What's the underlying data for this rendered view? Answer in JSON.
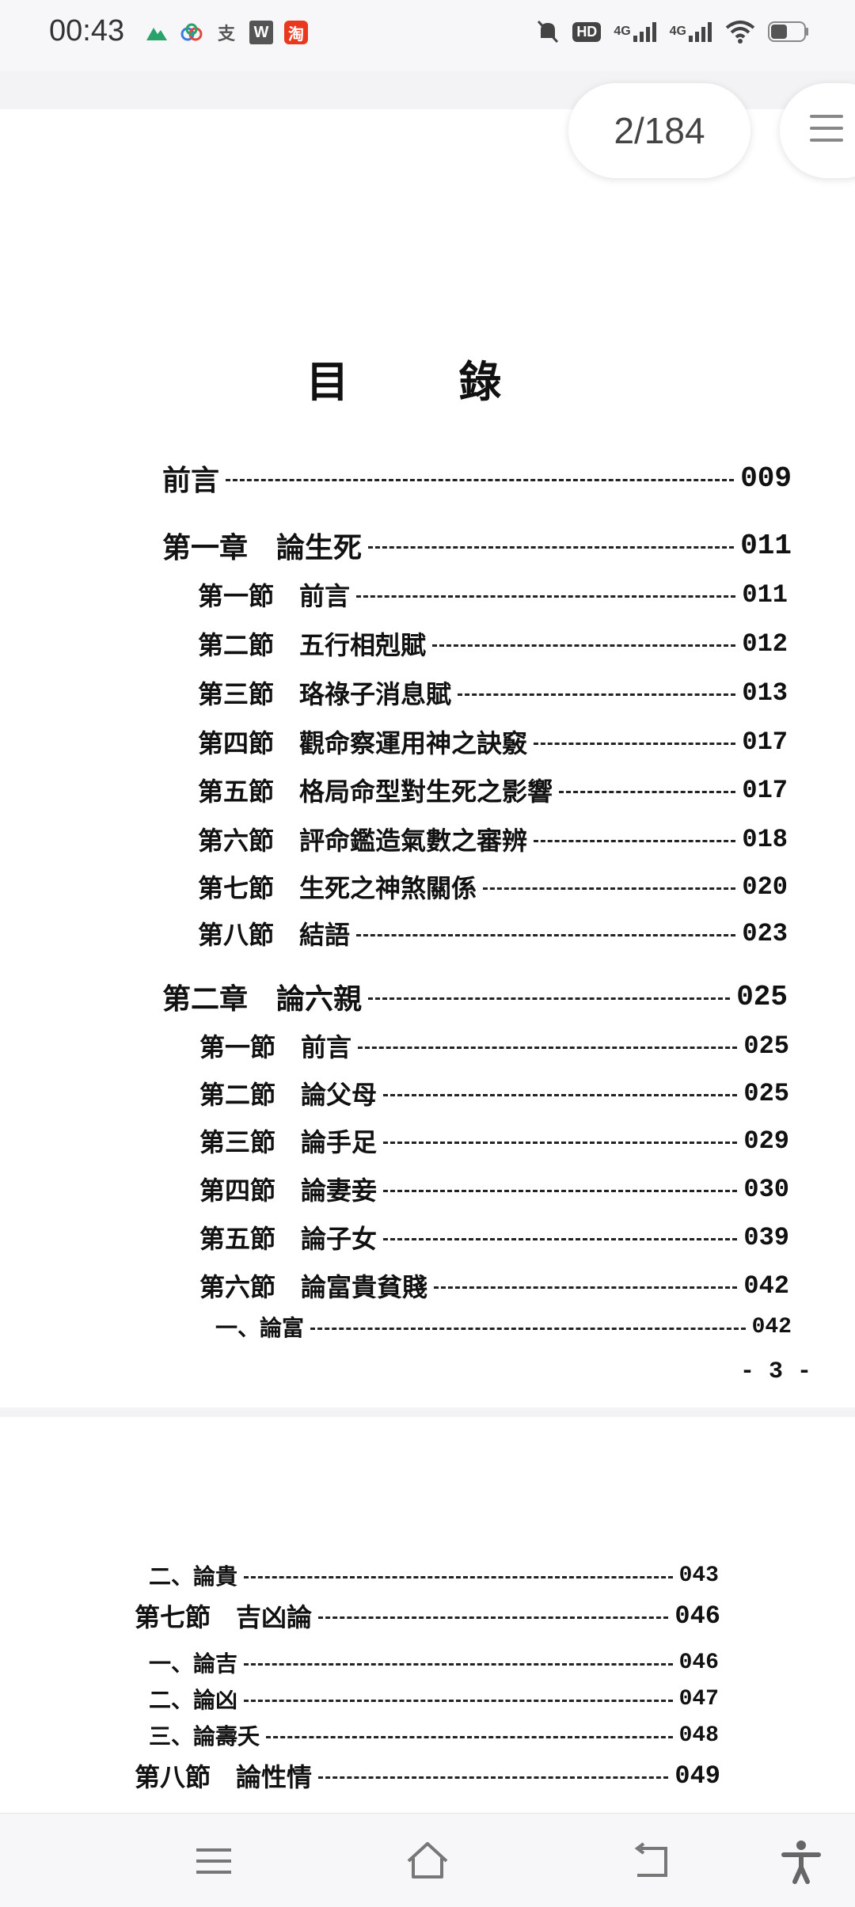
{
  "status_bar": {
    "time": "00:43",
    "app_icons": [
      "mountain-icon",
      "cloud-icon",
      "alipay-icon",
      "wps-icon",
      "taobao-icon"
    ],
    "app_glyphs": {
      "alipay": "支",
      "wps": "W",
      "taobao": "淘"
    },
    "network": [
      "HD",
      "4G",
      "4G"
    ],
    "system_icons": [
      "mute-icon",
      "hd-icon",
      "signal-icon",
      "signal-icon",
      "wifi-icon",
      "battery-icon"
    ]
  },
  "reader": {
    "page_indicator": "2/184"
  },
  "page_top": {
    "title": "目 錄",
    "page_footer": "- 3 -",
    "entries": [
      {
        "label": "前言",
        "page": "009"
      },
      {
        "label": "第一章　論生死",
        "page": "011"
      },
      {
        "label": "第一節　前言",
        "page": "011"
      },
      {
        "label": "第二節　五行相剋賦",
        "page": "012"
      },
      {
        "label": "第三節　珞祿子消息賦",
        "page": "013"
      },
      {
        "label": "第四節　觀命察運用神之訣竅",
        "page": "017"
      },
      {
        "label": "第五節　格局命型對生死之影響",
        "page": "017"
      },
      {
        "label": "第六節　評命鑑造氣數之審辨",
        "page": "018"
      },
      {
        "label": "第七節　生死之神煞關係",
        "page": "020"
      },
      {
        "label": "第八節　結語",
        "page": "023"
      },
      {
        "label": "第二章　論六親",
        "page": "025"
      },
      {
        "label": "第一節　前言",
        "page": "025"
      },
      {
        "label": "第二節　論父母",
        "page": "025"
      },
      {
        "label": "第三節　論手足",
        "page": "029"
      },
      {
        "label": "第四節　論妻妾",
        "page": "030"
      },
      {
        "label": "第五節　論子女",
        "page": "039"
      },
      {
        "label": "第六節　論富貴貧賤",
        "page": "042"
      },
      {
        "label": "一、論富",
        "page": "042"
      }
    ]
  },
  "page_bottom": {
    "entries": [
      {
        "label": "二、論貴",
        "page": "043"
      },
      {
        "label": "第七節　吉凶論",
        "page": "046"
      },
      {
        "label": "一、論吉",
        "page": "046"
      },
      {
        "label": "二、論凶",
        "page": "047"
      },
      {
        "label": "三、論壽夭",
        "page": "048"
      },
      {
        "label": "第八節　論性情",
        "page": "049"
      }
    ]
  },
  "nav": {
    "buttons": [
      "menu-icon",
      "home-icon",
      "back-icon",
      "accessibility-icon"
    ]
  }
}
